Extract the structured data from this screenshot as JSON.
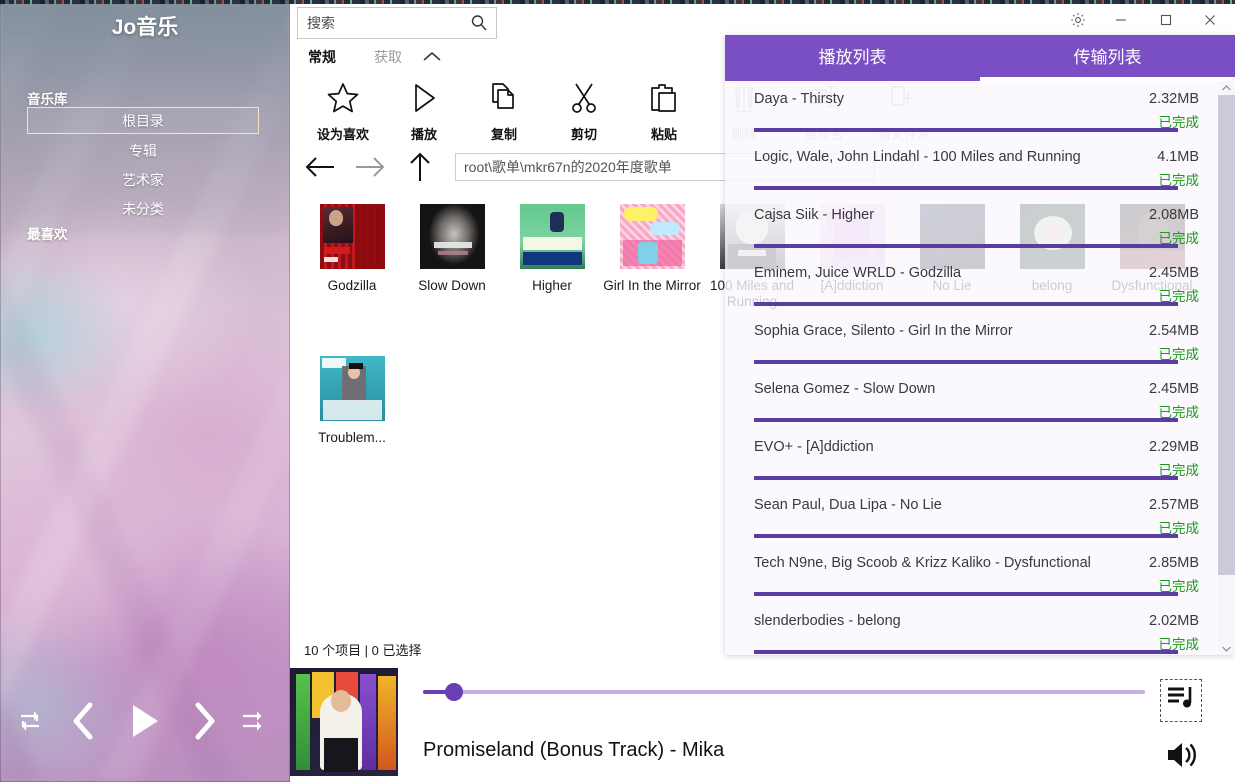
{
  "app": {
    "title": "Jo音乐",
    "sidebar": {
      "sections": [
        {
          "heading": "音乐库",
          "items": [
            "根目录",
            "专辑",
            "艺术家",
            "未分类"
          ],
          "selected": "根目录"
        },
        {
          "heading": "最喜欢",
          "items": []
        }
      ]
    },
    "transport": {
      "repeat_label": "repeat-icon",
      "prev_label": "previous-icon",
      "play_label": "play-icon",
      "next_label": "next-icon",
      "shuffle_label": "shuffle-icon"
    }
  },
  "explorer": {
    "search": {
      "placeholder": "搜索",
      "value": "",
      "icon": "search-icon"
    },
    "window_controls": {
      "settings": "gear-icon",
      "minimize": "minimize-icon",
      "maximize": "maximize-icon",
      "close": "close-icon"
    },
    "ribbon_tabs": [
      {
        "label": "常规",
        "active": true
      },
      {
        "label": "获取",
        "active": false
      }
    ],
    "ribbon_collapse_icon": "chevron-up-icon",
    "ribbon_buttons": [
      {
        "label": "设为喜欢",
        "icon": "star-icon",
        "disabled": false
      },
      {
        "label": "播放",
        "icon": "play-triangle-icon",
        "disabled": false
      },
      {
        "label": "复制",
        "icon": "copy-icon",
        "disabled": false
      },
      {
        "label": "剪切",
        "icon": "scissors-icon",
        "disabled": false
      },
      {
        "label": "粘贴",
        "icon": "clipboard-icon",
        "disabled": false
      },
      {
        "label": "删除",
        "icon": "trash-icon",
        "disabled": true
      },
      {
        "label": "重命名",
        "icon": "rename-icon",
        "disabled": true
      },
      {
        "label": "新文件夹",
        "icon": "new-folder-icon",
        "disabled": true
      }
    ],
    "nav": {
      "back": "arrow-left-icon",
      "forward": "arrow-right-icon",
      "up": "arrow-up-icon"
    },
    "address": "root\\歌单\\mkr67n的2020年度歌单",
    "files": [
      {
        "name": "Godzilla"
      },
      {
        "name": "Slow Down"
      },
      {
        "name": "Higher"
      },
      {
        "name": "Girl In the Mirror"
      },
      {
        "name": "100 Miles and Running"
      },
      {
        "name": "[A]ddiction"
      },
      {
        "name": "No Lie"
      },
      {
        "name": "belong"
      },
      {
        "name": "Dysfunctional"
      },
      {
        "name": "Troublem..."
      }
    ],
    "status": "10 个项目 | 0 已选择"
  },
  "panel": {
    "tabs": [
      {
        "label": "播放列表",
        "active": false
      },
      {
        "label": "传输列表",
        "active": true
      }
    ],
    "scroll": {
      "up_icon": "chevron-up-icon",
      "down_icon": "chevron-down-icon"
    },
    "transfers": [
      {
        "name": "Daya - Thirsty",
        "size": "2.32MB",
        "status": "已完成",
        "progress": 100
      },
      {
        "name": "Logic, Wale, John Lindahl - 100 Miles and Running",
        "size": "4.1MB",
        "status": "已完成",
        "progress": 100
      },
      {
        "name": "Cajsa Siik - Higher",
        "size": "2.08MB",
        "status": "已完成",
        "progress": 100
      },
      {
        "name": "Eminem, Juice WRLD - Godzilla",
        "size": "2.45MB",
        "status": "已完成",
        "progress": 100
      },
      {
        "name": "Sophia Grace, Silento - Girl In the Mirror",
        "size": "2.54MB",
        "status": "已完成",
        "progress": 100
      },
      {
        "name": "Selena Gomez - Slow Down",
        "size": "2.45MB",
        "status": "已完成",
        "progress": 100
      },
      {
        "name": "EVO+ - [A]ddiction",
        "size": "2.29MB",
        "status": "已完成",
        "progress": 100
      },
      {
        "name": "Sean Paul, Dua Lipa - No Lie",
        "size": "2.57MB",
        "status": "已完成",
        "progress": 100
      },
      {
        "name": "Tech N9ne, Big Scoob & Krizz Kaliko - Dysfunctional",
        "size": "2.85MB",
        "status": "已完成",
        "progress": 100
      },
      {
        "name": "slenderbodies - belong",
        "size": "2.02MB",
        "status": "已完成",
        "progress": 100
      }
    ]
  },
  "now_playing": {
    "title": "Promiseland (Bonus Track)  -  Mika",
    "progress_percent": 3,
    "playlist_icon": "playlist-music-icon",
    "volume_icon": "volume-icon"
  },
  "colors": {
    "accent": "#7b4fc4",
    "progress": "#5b3ca0",
    "status_done": "#1a9b1a",
    "panel_bg": "#faf8fd"
  }
}
